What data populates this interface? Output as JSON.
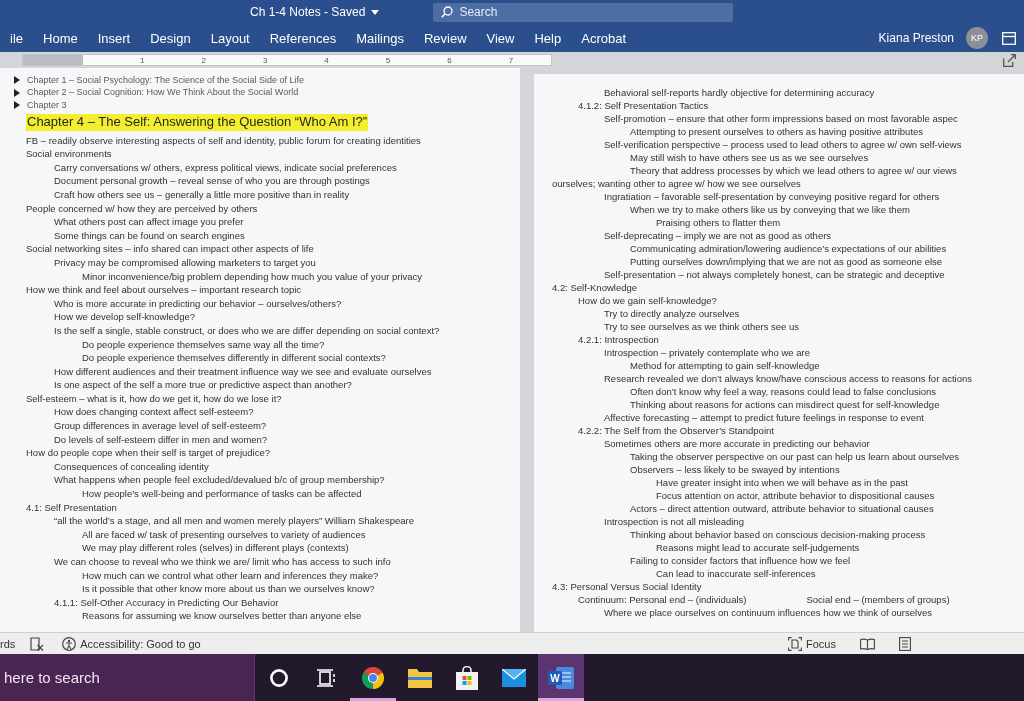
{
  "title_bar": {
    "document_title": "Ch 1-4 Notes - Saved",
    "search": {
      "placeholder": "Search"
    }
  },
  "ribbon": {
    "tabs": [
      "ile",
      "Home",
      "Insert",
      "Design",
      "Layout",
      "References",
      "Mailings",
      "Review",
      "View",
      "Help",
      "Acrobat"
    ],
    "user": {
      "name": "Kiana Preston",
      "initials": "KP"
    }
  },
  "ruler": {
    "marks": [
      "1",
      "2",
      "3",
      "4",
      "5",
      "6",
      "7"
    ]
  },
  "left_page": {
    "headings": [
      {
        "text": "Chapter 1 – Social Psychology: The Science of the Social Side of Life",
        "collapsed": true,
        "highlighted": false
      },
      {
        "text": "Chapter 2 – Social Cognition: How We Think About the Social World",
        "collapsed": true,
        "highlighted": false
      },
      {
        "text": "Chapter 3",
        "collapsed": true,
        "highlighted": false
      },
      {
        "text": "Chapter 4 – The Self: Answering the Question “Who Am I?”",
        "collapsed": false,
        "highlighted": true
      }
    ],
    "outline": [
      {
        "text": "FB – readily observe interesting aspects of self and identity, public forum for creating identities"
      },
      {
        "text": "Social environments",
        "children": [
          {
            "text": "Carry conversations w/ others, express political views, indicate social preferences"
          },
          {
            "text": "Document personal growth – reveal sense of who you are through postings"
          },
          {
            "text": "Craft how others see us – generally a little more positive than in reality"
          }
        ]
      },
      {
        "text": "People concerned w/ how they are perceived by others",
        "children": [
          {
            "text": "What others post can affect image you prefer"
          },
          {
            "text": "Some things can be found on search engines"
          }
        ]
      },
      {
        "text": "Social networking sites – info shared can impact other aspects of life",
        "children": [
          {
            "text": "Privacy may be compromised allowing marketers to target you",
            "children": [
              {
                "text": "Minor inconvenience/big problem depending how much you value of your privacy"
              }
            ]
          }
        ]
      },
      {
        "text": "How we think and feel about ourselves – important research topic",
        "children": [
          {
            "text": "Who is more accurate in predicting our behavior – ourselves/others?"
          },
          {
            "text": "How we develop self-knowledge?"
          },
          {
            "text": "Is the self a single, stable construct, or does who we are differ depending on social context?",
            "children": [
              {
                "text": "Do people experience themselves same way all the time?"
              },
              {
                "text": "Do people experience themselves differently in different social contexts?"
              }
            ]
          },
          {
            "text": "How different audiences and their treatment influence way we see and evaluate ourselves"
          },
          {
            "text": "Is one aspect of the self a more true or predictive aspect than another?"
          }
        ]
      },
      {
        "text": "Self-esteem – what is it, how do we get it, how do we lose it?",
        "children": [
          {
            "text": "How does changing context affect self-esteem?"
          },
          {
            "text": "Group differences in average level of self-esteem?"
          },
          {
            "text": "Do levels of self-esteem differ in men and women?"
          }
        ]
      },
      {
        "text": "How do people cope when their self is target of prejudice?",
        "children": [
          {
            "text": "Consequences of concealing identity"
          },
          {
            "text": "What happens when people feel excluded/devalued b/c of group membership?",
            "children": [
              {
                "text": "How people’s well-being and performance of tasks can be affected"
              }
            ]
          }
        ]
      },
      {
        "text": "4.1: Self Presentation",
        "children": [
          {
            "text": "“all the world’s a stage, and all men and women merely players” William Shakespeare",
            "children": [
              {
                "text": "All are faced w/ task of presenting ourselves to variety of audiences"
              },
              {
                "text": "We may play different roles (selves) in different plays (contexts)"
              }
            ]
          },
          {
            "text": "We can choose to reveal who we think we are/ limit who has access to such info",
            "children": [
              {
                "text": "How much can we control what other learn and inferences they make?"
              },
              {
                "text": "Is it possible that other know more about us than we ourselves know?"
              }
            ]
          },
          {
            "text": "4.1.1: Self-Other Accuracy in Predicting Our Behavior",
            "children": [
              {
                "text": "Reasons for assuming we know ourselves better than anyone else"
              }
            ]
          }
        ]
      }
    ]
  },
  "right_page": {
    "outline": [
      {
        "children": [
          {
            "children": [
              {
                "text": "Behavioral self-reports hardly objective for determining accuracy"
              }
            ]
          },
          {
            "text": "4.1.2: Self Presentation Tactics",
            "children": [
              {
                "text": "Self-promotion – ensure that other form impressions based on most favorable aspec",
                "children": [
                  {
                    "text": "Attempting to present ourselves to others as having positive attributes"
                  }
                ]
              },
              {
                "text": "Self-verification perspective – process used to lead others to agree w/ own self-views",
                "children": [
                  {
                    "text": "May still wish to have others see us as we see ourselves"
                  },
                  {
                    "text": "Theory that address processes by which we lead others to agree w/ our views",
                    "wrapped_line": "ourselves; wanting other to agree w/ how we see ourselves"
                  }
                ]
              },
              {
                "text": "Ingratiation – favorable self-presentation by conveying positive regard for others",
                "children": [
                  {
                    "text": "When we try to make others like us by conveying that we like them",
                    "children": [
                      {
                        "text": "Praising others to flatter them"
                      }
                    ]
                  }
                ]
              },
              {
                "text": "Self-deprecating – imply we are not as good as others",
                "children": [
                  {
                    "text": "Communicating admiration/lowering audience’s expectations of our abilities"
                  },
                  {
                    "text": "Putting ourselves down/implying that we are not as good as someone else"
                  }
                ]
              },
              {
                "text": "Self-presentation – not always completely honest, can be strategic and deceptive"
              }
            ]
          }
        ]
      },
      {
        "text": "4.2: Self-Knowledge",
        "children": [
          {
            "text": "How do we gain self-knowledge?",
            "children": [
              {
                "text": "Try to directly analyze ourselves"
              },
              {
                "text": "Try to see ourselves as we think others see us"
              }
            ]
          },
          {
            "text": "4.2.1: Introspection",
            "children": [
              {
                "text": "Introspection – privately contemplate who we are",
                "children": [
                  {
                    "text": "Method for attempting to gain self-knowledge"
                  }
                ]
              },
              {
                "text": "Research revealed we don’t always know/have conscious access to reasons for actions",
                "children": [
                  {
                    "text": "Often don’t know why feel a way, reasons could lead to false conclusions"
                  },
                  {
                    "text": "Thinking about reasons for actions can misdirect quest for self-knowledge"
                  }
                ]
              },
              {
                "text": "Affective forecasting – attempt to predict future feelings in response to event"
              }
            ]
          },
          {
            "text": "4.2.2: The Self from the Observer’s Standpoint",
            "children": [
              {
                "text": "Sometimes others are more accurate in predicting our behavior",
                "children": [
                  {
                    "text": "Taking the observer perspective on our past can help us learn about ourselves"
                  },
                  {
                    "text": "Observers – less likely to be swayed by intentions",
                    "children": [
                      {
                        "text": "Have greater insight into when we will behave as in the past"
                      },
                      {
                        "text": "Focus attention on actor, attribute behavior to dispositional causes"
                      }
                    ]
                  },
                  {
                    "text": "Actors – direct attention outward, attribute behavior to situational causes"
                  }
                ]
              },
              {
                "text": "Introspection is not all misleading",
                "children": [
                  {
                    "text": "Thinking about behavior based on conscious decision-making process",
                    "children": [
                      {
                        "text": "Reasons might lead to accurate self-judgements"
                      }
                    ]
                  },
                  {
                    "text": "Failing to consider factors that influence how we feel",
                    "children": [
                      {
                        "text": "Can lead to inaccurate self-inferences"
                      }
                    ]
                  }
                ]
              }
            ]
          }
        ]
      },
      {
        "text": "4.3: Personal Versus Social Identity",
        "children": [
          {
            "text": "Continuum: Personal end – (individuals)",
            "right_text": "Social end – (members of groups)",
            "children": [
              {
                "text": "Where we place ourselves on continuum influences how we think of ourselves"
              }
            ]
          }
        ]
      }
    ]
  },
  "status_bar": {
    "word_count": "rds",
    "accessibility": "Accessibility: Good to go",
    "focus": "Focus"
  },
  "taskbar": {
    "search": {
      "placeholder": "here to search"
    },
    "apps": [
      {
        "kind": "ring",
        "running": false,
        "active": false
      },
      {
        "kind": "taskview",
        "running": false,
        "active": false
      },
      {
        "kind": "wheel",
        "running": true,
        "active": false
      },
      {
        "kind": "folder",
        "running": false,
        "active": false
      },
      {
        "kind": "bag",
        "running": false,
        "active": false
      },
      {
        "kind": "mail",
        "running": false,
        "active": false
      },
      {
        "kind": "doc",
        "label": "W",
        "running": true,
        "active": true
      }
    ]
  }
}
